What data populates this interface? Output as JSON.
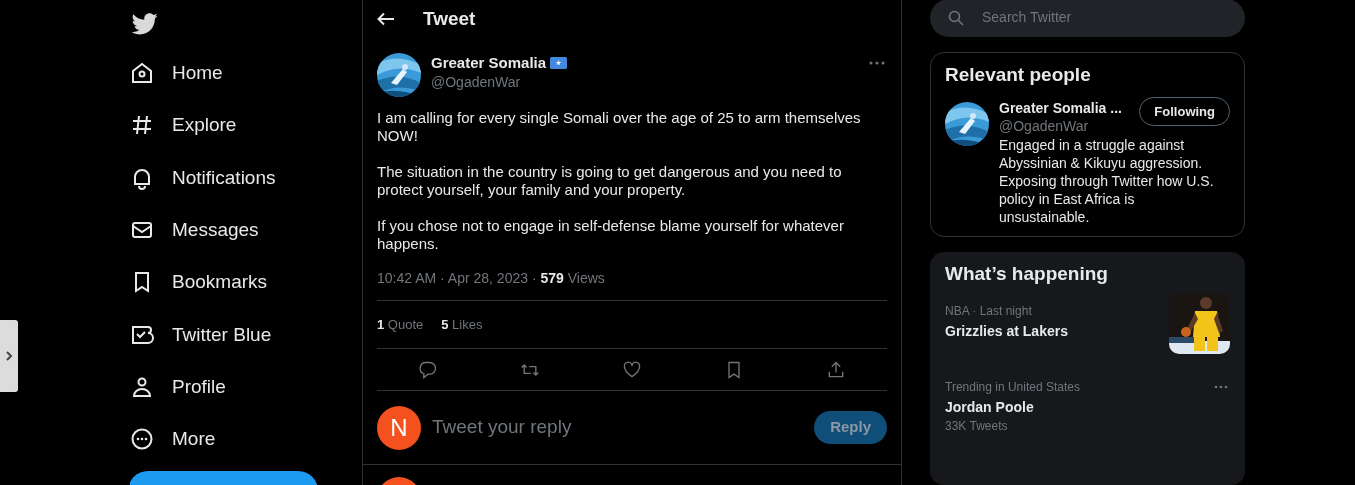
{
  "nav": {
    "items": [
      {
        "label": "Home"
      },
      {
        "label": "Explore"
      },
      {
        "label": "Notifications"
      },
      {
        "label": "Messages"
      },
      {
        "label": "Bookmarks"
      },
      {
        "label": "Twitter Blue"
      },
      {
        "label": "Profile"
      },
      {
        "label": "More"
      }
    ]
  },
  "header": {
    "title": "Tweet"
  },
  "tweet": {
    "name": "Greater Somalia",
    "handle": "@OgadenWar",
    "paragraphs": [
      "I am calling for every single Somali over the age of 25 to arm themselves NOW!",
      "The situation in the country is going to get dangerous and you need to protect yourself, your family and your property.",
      "If you chose not to engage in self-defense blame yourself for whatever happens."
    ],
    "meta": "10:42 AM · Apr 28, 2023 · **579** Views",
    "stats": [
      "**1** Quote",
      "**5** Likes"
    ]
  },
  "reply_box": {
    "avatar_letter": "N",
    "placeholder": "Tweet your reply",
    "button": "Reply"
  },
  "search": {
    "placeholder": "Search Twitter"
  },
  "relevant_people": {
    "title": "Relevant people",
    "people": [
      {
        "name": "Greater Somalia ...",
        "handle": "@OgadenWar",
        "bio": "Engaged in a struggle against Abyssinian & Kikuyu aggression. Exposing through Twitter how U.S. policy in East Africa is unsustainable.",
        "button": "Following"
      }
    ]
  },
  "whats_happening": {
    "title": "What’s happening",
    "trends": [
      {
        "kind": "picture",
        "context": "NBA · Last night",
        "title": "Grizzlies at Lakers"
      },
      {
        "kind": "more",
        "context": "Trending in United States",
        "title": "Jordan Poole",
        "count": "33K Tweets"
      }
    ]
  }
}
